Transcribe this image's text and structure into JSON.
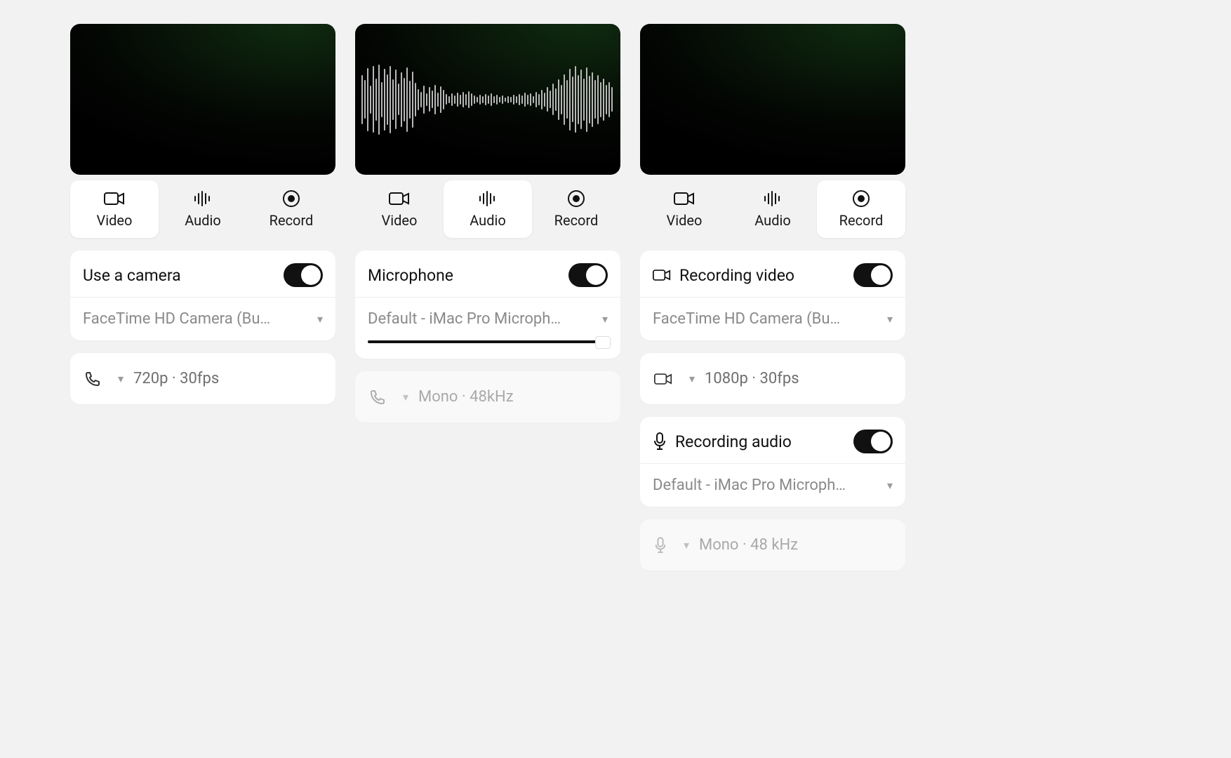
{
  "tabs": {
    "video": "Video",
    "audio": "Audio",
    "record": "Record"
  },
  "panels": [
    {
      "active_tab": "video",
      "camera": {
        "title": "Use a camera",
        "device": "FaceTime HD Camera (Bu…",
        "quality": "720p · 30fps"
      }
    },
    {
      "active_tab": "audio",
      "mic": {
        "title": "Microphone",
        "device": "Default - iMac Pro Microph…",
        "quality": "Mono · 48kHz"
      }
    },
    {
      "active_tab": "record",
      "rec_video": {
        "title": "Recording video",
        "device": "FaceTime HD Camera (Bu…",
        "quality": "1080p · 30fps"
      },
      "rec_audio": {
        "title": "Recording audio",
        "device": "Default - iMac Pro Microph…",
        "quality": "Mono · 48 kHz"
      }
    }
  ]
}
